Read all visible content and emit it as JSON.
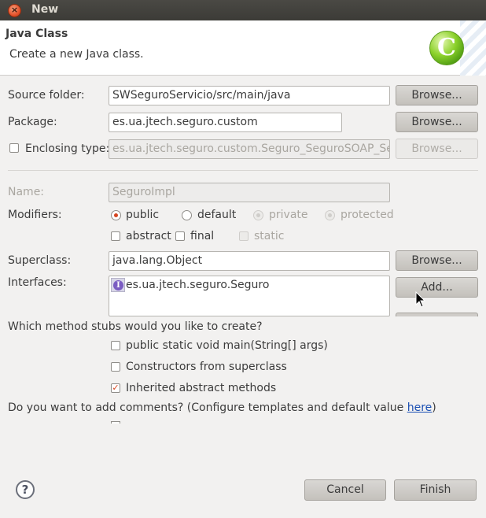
{
  "window": {
    "title": "New",
    "close_icon": "close-icon"
  },
  "banner": {
    "title": "Java Class",
    "description": "Create a new Java class.",
    "logo_letter": "C"
  },
  "form": {
    "source_folder": {
      "label": "Source folder:",
      "value": "SWSeguroServicio/src/main/java",
      "button": "Browse..."
    },
    "package": {
      "label": "Package:",
      "value": "es.ua.jtech.seguro.custom",
      "button": "Browse..."
    },
    "enclosing_type": {
      "label": "Enclosing type:",
      "value": "es.ua.jtech.seguro.custom.Seguro_SeguroSOAP_Serve",
      "button": "Browse...",
      "checked": false
    },
    "name": {
      "label": "Name:",
      "value": "SeguroImpl"
    },
    "modifiers": {
      "label": "Modifiers:",
      "public": "public",
      "default": "default",
      "private": "private",
      "protected": "protected",
      "abstract": "abstract",
      "final": "final",
      "static": "static",
      "selected": "public"
    },
    "superclass": {
      "label": "Superclass:",
      "value": "java.lang.Object",
      "button": "Browse..."
    },
    "interfaces": {
      "label": "Interfaces:",
      "items": [
        "es.ua.jtech.seguro.Seguro"
      ],
      "icon_letter": "I",
      "add_button": "Add..."
    }
  },
  "stubs": {
    "question": "Which method stubs would you like to create?",
    "main": "public static void main(String[] args)",
    "constructors": "Constructors from superclass",
    "inherited": "Inherited abstract methods",
    "main_checked": false,
    "constructors_checked": false,
    "inherited_checked": true
  },
  "comments": {
    "question_prefix": "Do you want to add comments? (Configure templates and default value ",
    "link": "here",
    "question_suffix": ")"
  },
  "footer": {
    "help_icon": "help-icon",
    "cancel": "Cancel",
    "finish": "Finish"
  },
  "colors": {
    "accent": "#d64520",
    "titlebar": "#3c3b37",
    "background": "#f2f1f0"
  }
}
